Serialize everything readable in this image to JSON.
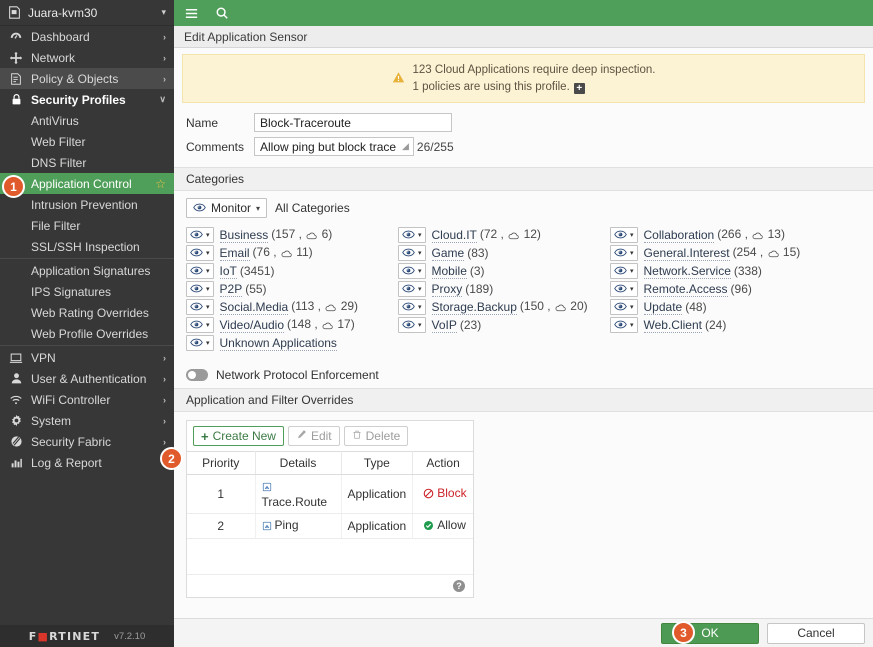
{
  "sidebar": {
    "device": {
      "name": "Juara-kvm30",
      "icon": "device-icon",
      "caret": "▾"
    },
    "items": [
      {
        "label": "Dashboard",
        "icon": "dashboard-icon",
        "arrow": "›",
        "state": "collapsed"
      },
      {
        "label": "Network",
        "icon": "network-icon",
        "arrow": "›",
        "state": "collapsed"
      },
      {
        "label": "Policy & Objects",
        "icon": "policy-icon",
        "arrow": "›",
        "state": "hover"
      },
      {
        "label": "Security Profiles",
        "icon": "lock-icon",
        "arrow": "∨",
        "state": "expanded"
      }
    ],
    "security_profiles_children": [
      {
        "label": "AntiVirus",
        "selected": false
      },
      {
        "label": "Web Filter",
        "selected": false
      },
      {
        "label": "DNS Filter",
        "selected": false
      },
      {
        "label": "Application Control",
        "selected": true,
        "star": "☆"
      },
      {
        "label": "Intrusion Prevention",
        "selected": false
      },
      {
        "label": "File Filter",
        "selected": false
      },
      {
        "label": "SSL/SSH Inspection",
        "selected": false
      }
    ],
    "signatures_group": [
      {
        "label": "Application Signatures"
      },
      {
        "label": "IPS Signatures"
      },
      {
        "label": "Web Rating Overrides"
      },
      {
        "label": "Web Profile Overrides"
      }
    ],
    "bottom_items": [
      {
        "label": "VPN",
        "icon": "vpn-icon",
        "arrow": "›"
      },
      {
        "label": "User & Authentication",
        "icon": "user-icon",
        "arrow": "›"
      },
      {
        "label": "WiFi Controller",
        "icon": "wifi-icon",
        "arrow": "›"
      },
      {
        "label": "System",
        "icon": "gear-icon",
        "arrow": "›"
      },
      {
        "label": "Security Fabric",
        "icon": "fabric-icon",
        "arrow": "›"
      },
      {
        "label": "Log & Report",
        "icon": "chart-icon",
        "arrow": "›"
      }
    ],
    "footer": {
      "brand_f": "F",
      "brand_o": "■",
      "brand_rest": "RTINET",
      "version": "v7.2.10"
    }
  },
  "topbar": {
    "menu_icon": "hamburger-icon",
    "search_icon": "search-icon"
  },
  "breadcrumb": {
    "title": "Edit Application Sensor"
  },
  "warning": {
    "icon": "warning-triangle-icon",
    "line1": "123 Cloud Applications require deep inspection.",
    "line2": "1 policies are using this profile.",
    "expand_glyph": "+"
  },
  "form": {
    "name_label": "Name",
    "name_value": "Block-Traceroute",
    "comments_label": "Comments",
    "comments_value": "Allow ping but block trace",
    "comments_counter": "26/255"
  },
  "categories_section": {
    "header": "Categories",
    "monitor_button": {
      "label": "Monitor",
      "icon": "eye-icon",
      "caret": "▾"
    },
    "all_categories_label": "All Categories",
    "items": [
      {
        "name": "Business",
        "count": "157",
        "cloud": "6",
        "col": 1
      },
      {
        "name": "Email",
        "count": "76",
        "cloud": "11",
        "col": 1
      },
      {
        "name": "IoT",
        "count": "3451",
        "cloud": null,
        "col": 1
      },
      {
        "name": "P2P",
        "count": "55",
        "cloud": null,
        "col": 1
      },
      {
        "name": "Social.Media",
        "count": "113",
        "cloud": "29",
        "col": 1
      },
      {
        "name": "Video/Audio",
        "count": "148",
        "cloud": "17",
        "col": 1
      },
      {
        "name": "Unknown Applications",
        "count": null,
        "cloud": null,
        "col": 1
      },
      {
        "name": "Cloud.IT",
        "count": "72",
        "cloud": "12",
        "col": 2
      },
      {
        "name": "Game",
        "count": "83",
        "cloud": null,
        "col": 2
      },
      {
        "name": "Mobile",
        "count": "3",
        "cloud": null,
        "col": 2
      },
      {
        "name": "Proxy",
        "count": "189",
        "cloud": null,
        "col": 2
      },
      {
        "name": "Storage.Backup",
        "count": "150",
        "cloud": "20",
        "col": 2
      },
      {
        "name": "VoIP",
        "count": "23",
        "cloud": null,
        "col": 2
      },
      {
        "name": "Collaboration",
        "count": "266",
        "cloud": "13",
        "col": 3
      },
      {
        "name": "General.Interest",
        "count": "254",
        "cloud": "15",
        "col": 3
      },
      {
        "name": "Network.Service",
        "count": "338",
        "cloud": null,
        "col": 3
      },
      {
        "name": "Remote.Access",
        "count": "96",
        "cloud": null,
        "col": 3
      },
      {
        "name": "Update",
        "count": "48",
        "cloud": null,
        "col": 3
      },
      {
        "name": "Web.Client",
        "count": "24",
        "cloud": null,
        "col": 3
      }
    ]
  },
  "protocol_enforcement": {
    "label": "Network Protocol Enforcement",
    "enabled": false
  },
  "overrides": {
    "header": "Application and Filter Overrides",
    "toolbar": {
      "create_new": "Create New",
      "create_new_plus": "+",
      "edit": "Edit",
      "edit_icon": "pencil-icon",
      "delete": "Delete",
      "delete_icon": "trash-icon"
    },
    "columns": [
      "Priority",
      "Details",
      "Type",
      "Action"
    ],
    "rows": [
      {
        "priority": "1",
        "details": "Trace.Route",
        "details_icon": "application-icon",
        "type": "Application",
        "action": "Block",
        "action_icon": "block-icon"
      },
      {
        "priority": "2",
        "details": "Ping",
        "details_icon": "application-icon",
        "type": "Application",
        "action": "Allow",
        "action_icon": "allow-icon"
      }
    ],
    "help_glyph": "?"
  },
  "footer_buttons": {
    "ok": "OK",
    "cancel": "Cancel"
  },
  "callouts": [
    {
      "id": "1",
      "number": "1"
    },
    {
      "id": "2",
      "number": "2"
    },
    {
      "id": "3",
      "number": "3"
    }
  ],
  "colors": {
    "brand_green": "#4f9e59",
    "sidebar_bg": "#373737",
    "warning_bg": "#fcf3d4",
    "callout_orange": "#e05a2b",
    "block_red": "#cc2229",
    "allow_green": "#1f9b4e"
  }
}
